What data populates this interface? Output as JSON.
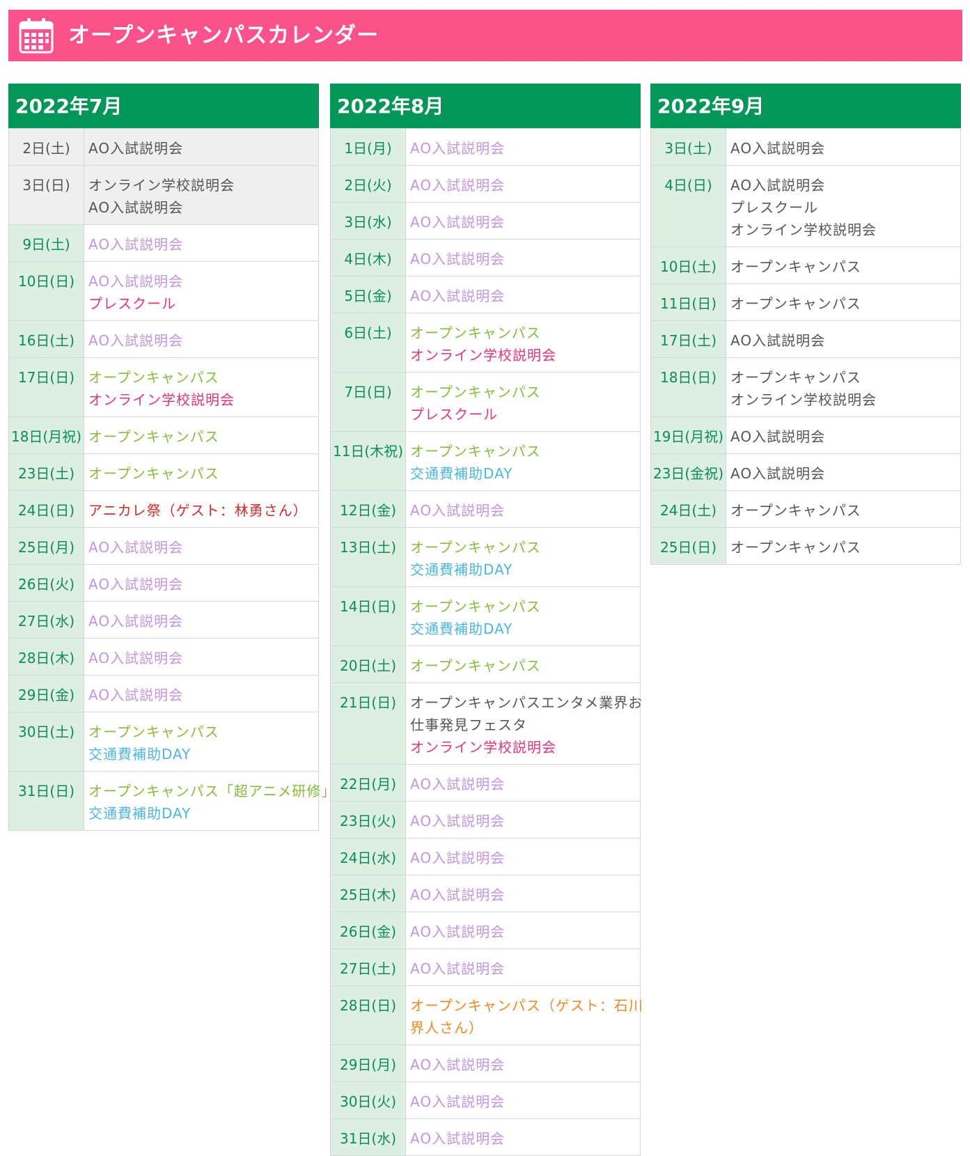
{
  "header": {
    "title": "オープンキャンパスカレンダー",
    "icon": "calendar-icon",
    "bg_color": "#fb5289"
  },
  "colors": {
    "month_header": "#039659",
    "date_cell": "#dcefe2",
    "date_text": "#0a8f53"
  },
  "months": [
    {
      "label": "2022年7月",
      "rows": [
        {
          "date": "2日(土)",
          "past": true,
          "events": [
            {
              "text": "AO入試説明会",
              "type": "gray"
            }
          ]
        },
        {
          "date": "3日(日)",
          "past": true,
          "events": [
            {
              "text": "オンライン学校説明会",
              "type": "gray"
            },
            {
              "text": "AO入試説明会",
              "type": "gray"
            }
          ]
        },
        {
          "date": "9日(土)",
          "events": [
            {
              "text": "AO入試説明会",
              "type": "ao"
            }
          ]
        },
        {
          "date": "10日(日)",
          "events": [
            {
              "text": "AO入試説明会",
              "type": "ao"
            },
            {
              "text": "プレスクール",
              "type": "pre"
            }
          ]
        },
        {
          "date": "16日(土)",
          "events": [
            {
              "text": "AO入試説明会",
              "type": "ao"
            }
          ]
        },
        {
          "date": "17日(日)",
          "events": [
            {
              "text": "オープンキャンパス",
              "type": "oc"
            },
            {
              "text": "オンライン学校説明会",
              "type": "onl"
            }
          ]
        },
        {
          "date": "18日(月祝)",
          "events": [
            {
              "text": "オープンキャンパス",
              "type": "oc"
            }
          ]
        },
        {
          "date": "23日(土)",
          "events": [
            {
              "text": "オープンキャンパス",
              "type": "oc"
            }
          ]
        },
        {
          "date": "24日(日)",
          "events": [
            {
              "text": "アニカレ祭（ゲスト：林勇さん）",
              "type": "ani"
            }
          ]
        },
        {
          "date": "25日(月)",
          "events": [
            {
              "text": "AO入試説明会",
              "type": "ao"
            }
          ]
        },
        {
          "date": "26日(火)",
          "events": [
            {
              "text": "AO入試説明会",
              "type": "ao"
            }
          ]
        },
        {
          "date": "27日(水)",
          "events": [
            {
              "text": "AO入試説明会",
              "type": "ao"
            }
          ]
        },
        {
          "date": "28日(木)",
          "events": [
            {
              "text": "AO入試説明会",
              "type": "ao"
            }
          ]
        },
        {
          "date": "29日(金)",
          "events": [
            {
              "text": "AO入試説明会",
              "type": "ao"
            }
          ]
        },
        {
          "date": "30日(土)",
          "events": [
            {
              "text": "オープンキャンパス",
              "type": "oc"
            },
            {
              "text": "交通費補助DAY",
              "type": "trv"
            }
          ]
        },
        {
          "date": "31日(日)",
          "events": [
            {
              "text": "オープンキャンパス「超アニメ研修」",
              "type": "oc"
            },
            {
              "text": "交通費補助DAY",
              "type": "trv"
            }
          ]
        }
      ]
    },
    {
      "label": "2022年8月",
      "rows": [
        {
          "date": "1日(月)",
          "events": [
            {
              "text": "AO入試説明会",
              "type": "ao"
            }
          ]
        },
        {
          "date": "2日(火)",
          "events": [
            {
              "text": "AO入試説明会",
              "type": "ao"
            }
          ]
        },
        {
          "date": "3日(水)",
          "events": [
            {
              "text": "AO入試説明会",
              "type": "ao"
            }
          ]
        },
        {
          "date": "4日(木)",
          "events": [
            {
              "text": "AO入試説明会",
              "type": "ao"
            }
          ]
        },
        {
          "date": "5日(金)",
          "events": [
            {
              "text": "AO入試説明会",
              "type": "ao"
            }
          ]
        },
        {
          "date": "6日(土)",
          "events": [
            {
              "text": "オープンキャンパス",
              "type": "oc"
            },
            {
              "text": "オンライン学校説明会",
              "type": "onl"
            }
          ]
        },
        {
          "date": "7日(日)",
          "events": [
            {
              "text": "オープンキャンパス",
              "type": "oc"
            },
            {
              "text": "プレスクール",
              "type": "pre"
            }
          ]
        },
        {
          "date": "11日(木祝)",
          "events": [
            {
              "text": "オープンキャンパス",
              "type": "oc"
            },
            {
              "text": "交通費補助DAY",
              "type": "trv"
            }
          ]
        },
        {
          "date": "12日(金)",
          "events": [
            {
              "text": "AO入試説明会",
              "type": "ao"
            }
          ]
        },
        {
          "date": "13日(土)",
          "events": [
            {
              "text": "オープンキャンパス",
              "type": "oc"
            },
            {
              "text": "交通費補助DAY",
              "type": "trv"
            }
          ]
        },
        {
          "date": "14日(日)",
          "events": [
            {
              "text": "オープンキャンパス",
              "type": "oc"
            },
            {
              "text": "交通費補助DAY",
              "type": "trv"
            }
          ]
        },
        {
          "date": "20日(土)",
          "events": [
            {
              "text": "オープンキャンパス",
              "type": "oc"
            }
          ]
        },
        {
          "date": "21日(日)",
          "events": [
            {
              "text": "オープンキャンパスエンタメ業界お",
              "type": "gray"
            },
            {
              "text": "仕事発見フェスタ",
              "type": "gray"
            },
            {
              "text": "オンライン学校説明会",
              "type": "onl"
            }
          ]
        },
        {
          "date": "22日(月)",
          "events": [
            {
              "text": "AO入試説明会",
              "type": "ao"
            }
          ]
        },
        {
          "date": "23日(火)",
          "events": [
            {
              "text": "AO入試説明会",
              "type": "ao"
            }
          ]
        },
        {
          "date": "24日(水)",
          "events": [
            {
              "text": "AO入試説明会",
              "type": "ao"
            }
          ]
        },
        {
          "date": "25日(木)",
          "events": [
            {
              "text": "AO入試説明会",
              "type": "ao"
            }
          ]
        },
        {
          "date": "26日(金)",
          "events": [
            {
              "text": "AO入試説明会",
              "type": "ao"
            }
          ]
        },
        {
          "date": "27日(土)",
          "events": [
            {
              "text": "AO入試説明会",
              "type": "ao"
            }
          ]
        },
        {
          "date": "28日(日)",
          "events": [
            {
              "text": "オープンキャンパス（ゲスト：石川",
              "type": "gst"
            },
            {
              "text": "界人さん）",
              "type": "gst"
            }
          ]
        },
        {
          "date": "29日(月)",
          "events": [
            {
              "text": "AO入試説明会",
              "type": "ao"
            }
          ]
        },
        {
          "date": "30日(火)",
          "events": [
            {
              "text": "AO入試説明会",
              "type": "ao"
            }
          ]
        },
        {
          "date": "31日(水)",
          "events": [
            {
              "text": "AO入試説明会",
              "type": "ao"
            }
          ]
        }
      ]
    },
    {
      "label": "2022年9月",
      "rows": [
        {
          "date": "3日(土)",
          "events": [
            {
              "text": "AO入試説明会",
              "type": "gray"
            }
          ]
        },
        {
          "date": "4日(日)",
          "events": [
            {
              "text": "AO入試説明会",
              "type": "gray"
            },
            {
              "text": "プレスクール",
              "type": "gray"
            },
            {
              "text": "オンライン学校説明会",
              "type": "gray"
            }
          ]
        },
        {
          "date": "10日(土)",
          "events": [
            {
              "text": "オープンキャンパス",
              "type": "gray"
            }
          ]
        },
        {
          "date": "11日(日)",
          "events": [
            {
              "text": "オープンキャンパス",
              "type": "gray"
            }
          ]
        },
        {
          "date": "17日(土)",
          "events": [
            {
              "text": "AO入試説明会",
              "type": "gray"
            }
          ]
        },
        {
          "date": "18日(日)",
          "events": [
            {
              "text": "オープンキャンパス",
              "type": "gray"
            },
            {
              "text": "オンライン学校説明会",
              "type": "gray"
            }
          ]
        },
        {
          "date": "19日(月祝)",
          "events": [
            {
              "text": "AO入試説明会",
              "type": "gray"
            }
          ]
        },
        {
          "date": "23日(金祝)",
          "events": [
            {
              "text": "AO入試説明会",
              "type": "gray"
            }
          ]
        },
        {
          "date": "24日(土)",
          "events": [
            {
              "text": "オープンキャンパス",
              "type": "gray"
            }
          ]
        },
        {
          "date": "25日(日)",
          "events": [
            {
              "text": "オープンキャンパス",
              "type": "gray"
            }
          ]
        }
      ]
    }
  ]
}
